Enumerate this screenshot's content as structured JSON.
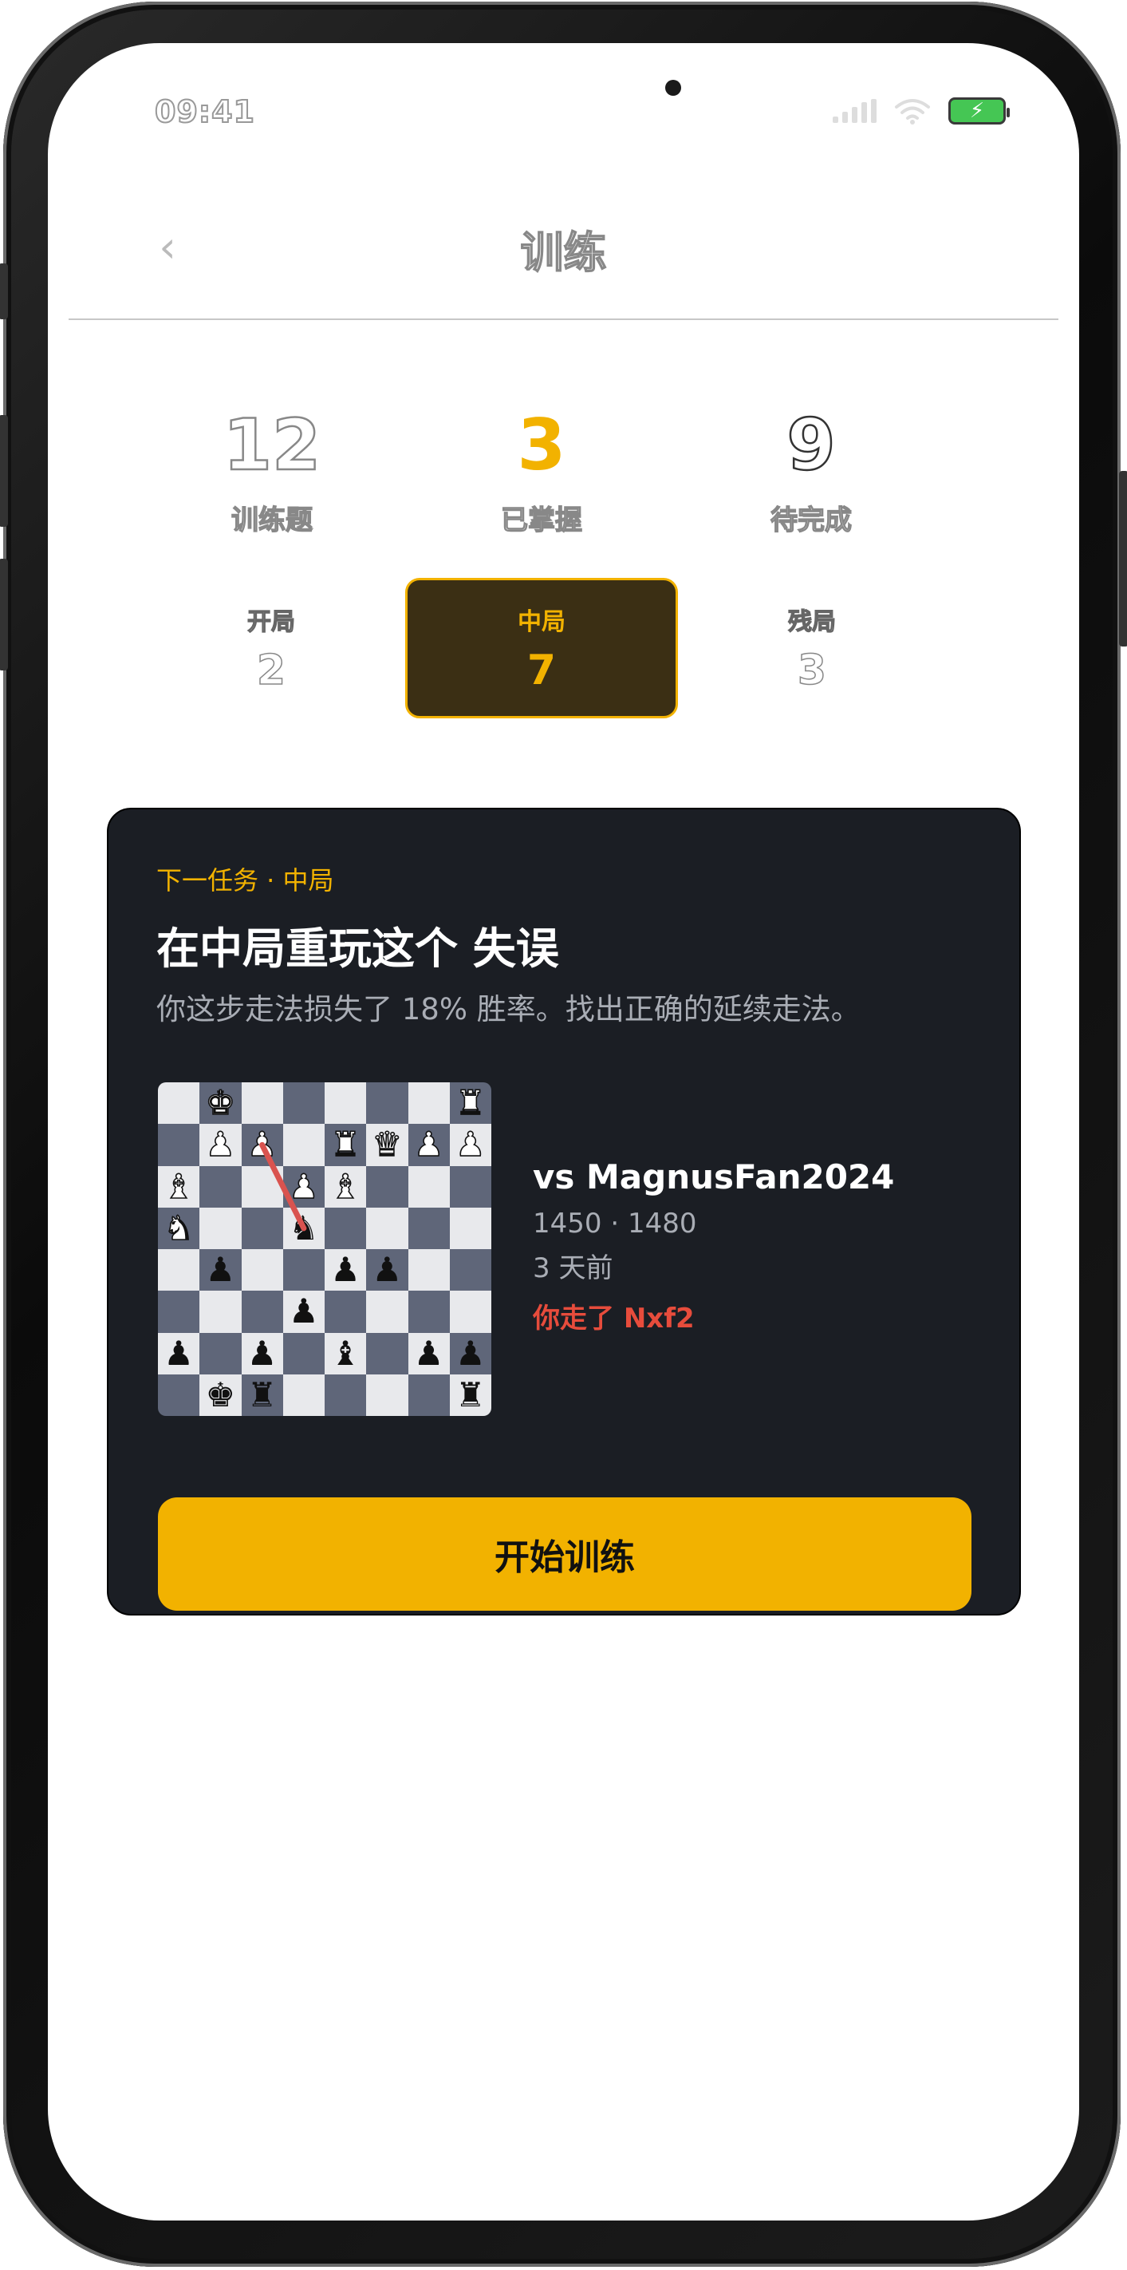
{
  "status": {
    "time": "09:41",
    "battery_symbol": "⚡"
  },
  "header": {
    "title": "训练"
  },
  "stats": [
    {
      "value": "12",
      "label": "训练题"
    },
    {
      "value": "3",
      "label": "已掌握"
    },
    {
      "value": "9",
      "label": "待完成"
    }
  ],
  "categories": [
    {
      "label": "开局",
      "count": "2",
      "active": false
    },
    {
      "label": "中局",
      "count": "7",
      "active": true
    },
    {
      "label": "残局",
      "count": "3",
      "active": false
    }
  ],
  "task": {
    "eyebrow": "下一任务 · 中局",
    "title": "在中局重玩这个 失误",
    "description": "你这步走法损失了 18% 胜率。找出正确的延续走法。",
    "opponent": "vs MagnusFan2024",
    "ratings": "1450 · 1480",
    "time_ago": "3 天前",
    "your_move": "你走了 Nxf2",
    "start_label": "开始训练"
  },
  "board": {
    "ranks": [
      [
        "",
        "K",
        "",
        "",
        "",
        "",
        "",
        "R"
      ],
      [
        "",
        "P",
        "P",
        "",
        "R",
        "Q",
        "P",
        "P"
      ],
      [
        "B",
        "",
        "",
        "P",
        "B",
        "",
        "",
        ""
      ],
      [
        "N",
        "",
        "",
        "n",
        "",
        "",
        "",
        ""
      ],
      [
        "",
        "p",
        "",
        "",
        "p",
        "p",
        "",
        ""
      ],
      [
        "",
        "",
        "",
        "p",
        "",
        "",
        "",
        ""
      ],
      [
        "p",
        "",
        "p",
        "",
        "b",
        "",
        "p",
        "p"
      ],
      [
        "",
        "k",
        "r",
        "",
        "",
        "",
        "",
        "r"
      ]
    ],
    "arrow_from": "c7",
    "arrow_to": "d5",
    "arrow_color": "#d9534f"
  },
  "colors": {
    "accent": "#f2b200",
    "card_bg": "#1b1e24",
    "error": "#e74c3c"
  }
}
